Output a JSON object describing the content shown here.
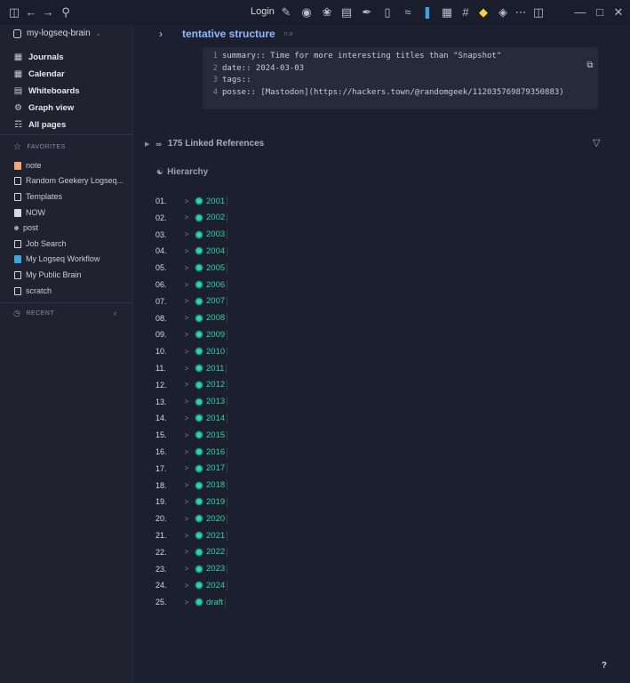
{
  "topbar": {
    "login_label": "Login",
    "left_icons": [
      "sidebar-toggle-icon",
      "back-arrow-icon",
      "forward-arrow-icon",
      "search-icon"
    ],
    "right_icons": [
      "pencil-icon",
      "palette-icon",
      "plugin-icon",
      "database-icon",
      "brush-icon",
      "phone-icon",
      "graph-icon",
      "vscode-icon",
      "calendar-icon",
      "hash-icon",
      "tag-icon",
      "puzzle-icon",
      "more-icon",
      "right-sidebar-icon",
      "minimize-icon",
      "maximize-icon",
      "close-icon"
    ]
  },
  "sidebar": {
    "graph_name": "my-logseq-brain",
    "nav": [
      {
        "label": "Journals",
        "icon": "calendar-icon"
      },
      {
        "label": "Calendar",
        "icon": "calendar-icon"
      },
      {
        "label": "Whiteboards",
        "icon": "whiteboard-icon"
      },
      {
        "label": "Graph view",
        "icon": "graph-icon"
      },
      {
        "label": "All pages",
        "icon": "pages-icon"
      }
    ],
    "favorites_heading": "FAVORITES",
    "favorites": [
      {
        "label": "note",
        "color": "#f0a57a"
      },
      {
        "label": "Random Geekery Logseq...",
        "color": "#d6d8e0"
      },
      {
        "label": "Templates",
        "color": "#d6d8e0"
      },
      {
        "label": "NOW",
        "color": "#d6d8e0"
      },
      {
        "label": "post",
        "color": "#9aa0b3"
      },
      {
        "label": "Job Search",
        "color": "#d6d8e0"
      },
      {
        "label": "My Logseq Workflow",
        "color": "#3fa3e0"
      },
      {
        "label": "My Public Brain",
        "color": "#d6d8e0"
      },
      {
        "label": "scratch",
        "color": "#d6d8e0"
      }
    ],
    "recent_heading": "RECENT"
  },
  "main": {
    "page_title": "tentative structure",
    "title_tag": "n.a",
    "code_lines": [
      {
        "n": "1",
        "text": "summary:: Time for more interesting titles than \"Snapshot\""
      },
      {
        "n": "2",
        "text": "date:: 2024-03-03"
      },
      {
        "n": "3",
        "text": "tags::"
      },
      {
        "n": "4",
        "text": "posse:: [Mastodon](https://hackers.town/@randomgeek/112035769879350883)"
      }
    ],
    "linked_refs_label": "175 Linked References",
    "hierarchy_title": "Hierarchy",
    "hierarchy": [
      {
        "num": "01.",
        "label": "2001"
      },
      {
        "num": "02.",
        "label": "2002"
      },
      {
        "num": "03.",
        "label": "2003"
      },
      {
        "num": "04.",
        "label": "2004"
      },
      {
        "num": "05.",
        "label": "2005"
      },
      {
        "num": "06.",
        "label": "2006"
      },
      {
        "num": "07.",
        "label": "2007"
      },
      {
        "num": "08.",
        "label": "2008"
      },
      {
        "num": "09.",
        "label": "2009"
      },
      {
        "num": "10.",
        "label": "2010"
      },
      {
        "num": "11.",
        "label": "2011"
      },
      {
        "num": "12.",
        "label": "2012"
      },
      {
        "num": "13.",
        "label": "2013"
      },
      {
        "num": "14.",
        "label": "2014"
      },
      {
        "num": "15.",
        "label": "2015"
      },
      {
        "num": "16.",
        "label": "2016"
      },
      {
        "num": "17.",
        "label": "2017"
      },
      {
        "num": "18.",
        "label": "2018"
      },
      {
        "num": "19.",
        "label": "2019"
      },
      {
        "num": "20.",
        "label": "2020"
      },
      {
        "num": "21.",
        "label": "2021"
      },
      {
        "num": "22.",
        "label": "2022"
      },
      {
        "num": "23.",
        "label": "2023"
      },
      {
        "num": "24.",
        "label": "2024"
      },
      {
        "num": "25.",
        "label": "draft"
      }
    ],
    "help_label": "?"
  }
}
